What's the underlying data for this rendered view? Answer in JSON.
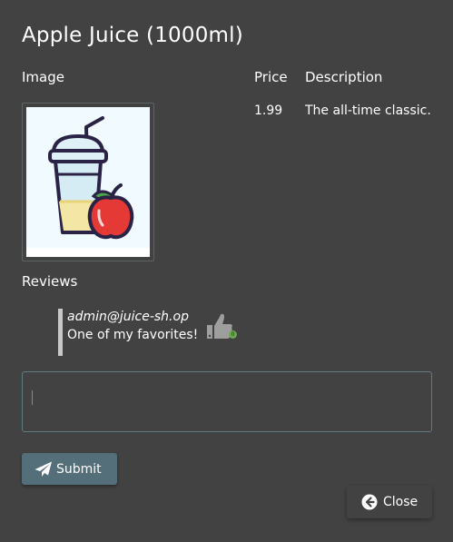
{
  "product": {
    "name": "Apple Juice (1000ml)",
    "price": "1.99",
    "description": "The all-time classic."
  },
  "columns": {
    "image": "Image",
    "price": "Price",
    "description": "Description"
  },
  "reviews": {
    "label": "Reviews",
    "items": [
      {
        "author": "admin@juice-sh.op",
        "text": "One of my favorites!",
        "likes": "0"
      }
    ]
  },
  "review_input": {
    "value": "",
    "placeholder": ""
  },
  "buttons": {
    "submit": "Submit",
    "close": "Close"
  },
  "icons": {
    "submit": "paper-plane-icon",
    "close": "arrow-circle-left-icon",
    "like": "thumbs-up-icon"
  },
  "colors": {
    "background": "#424242",
    "submit_button": "#546e7a",
    "like_badge": "#6aa84f"
  }
}
